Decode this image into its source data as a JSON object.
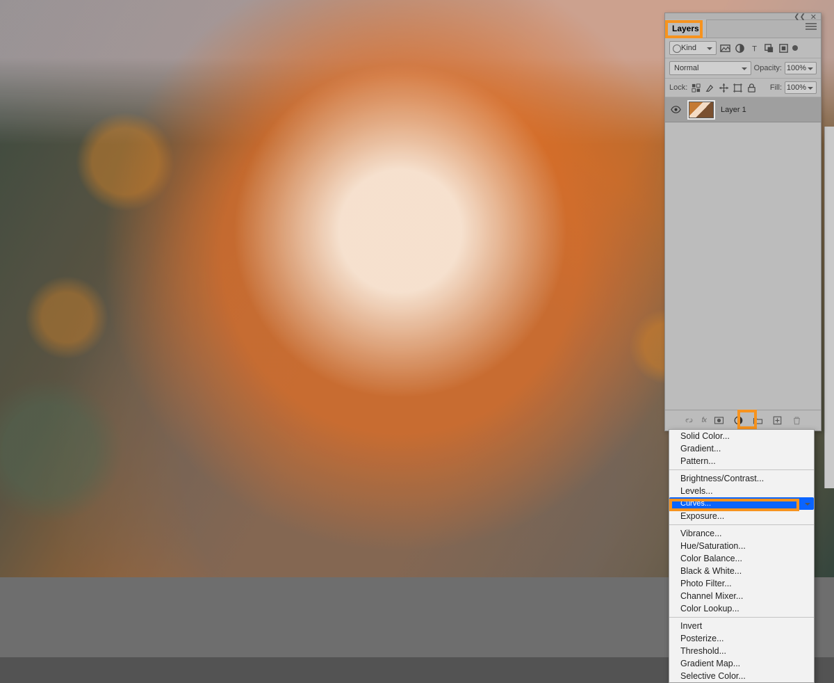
{
  "panel": {
    "tab_label": "Layers",
    "filter_kind": "Kind",
    "blend_mode": "Normal",
    "opacity_label": "Opacity:",
    "opacity_value": "100%",
    "lock_label": "Lock:",
    "fill_label": "Fill:",
    "fill_value": "100%",
    "fx_label": "fx",
    "layers": [
      {
        "name": "Layer 1",
        "visible": true
      }
    ]
  },
  "adjustment_menu": {
    "groups": [
      [
        "Solid Color...",
        "Gradient...",
        "Pattern..."
      ],
      [
        "Brightness/Contrast...",
        "Levels...",
        "Curves...",
        "Exposure..."
      ],
      [
        "Vibrance...",
        "Hue/Saturation...",
        "Color Balance...",
        "Black & White...",
        "Photo Filter...",
        "Channel Mixer...",
        "Color Lookup..."
      ],
      [
        "Invert",
        "Posterize...",
        "Threshold...",
        "Gradient Map...",
        "Selective Color..."
      ]
    ],
    "selected": "Curves..."
  },
  "highlight_color": "#f7931e"
}
